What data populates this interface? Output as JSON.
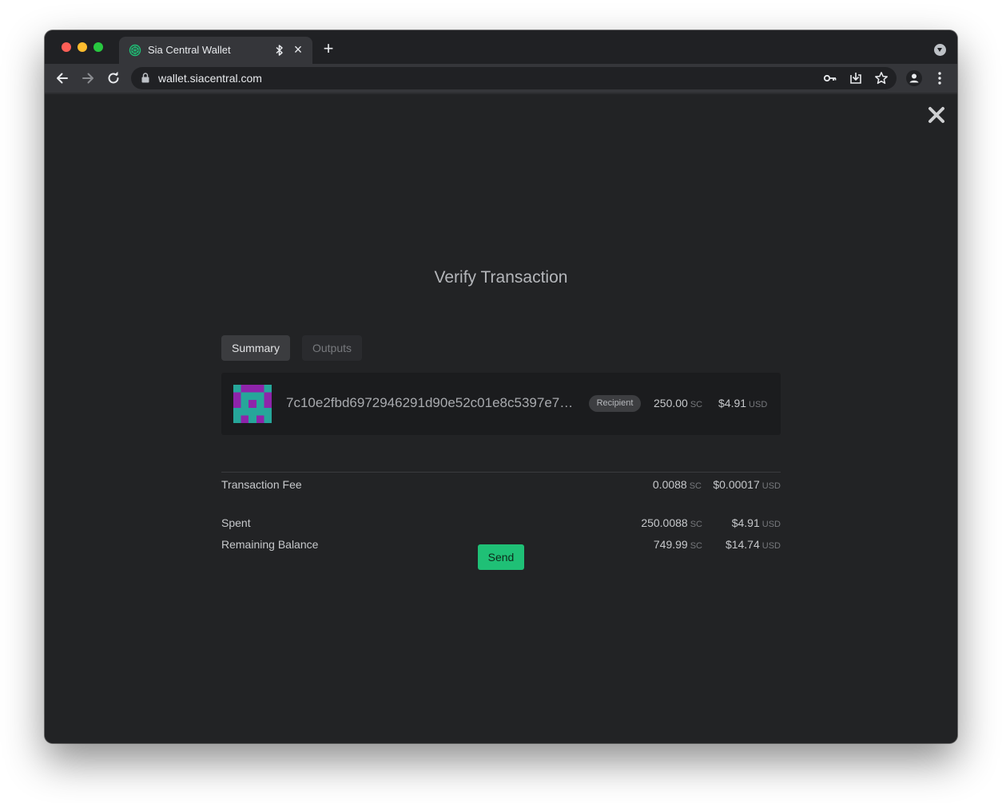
{
  "browser": {
    "tab_title": "Sia Central Wallet",
    "new_tab_symbol": "+",
    "close_tab_symbol": "×",
    "url": "wallet.siacentral.com"
  },
  "page": {
    "title": "Verify Transaction",
    "tabs": [
      {
        "label": "Summary",
        "active": true
      },
      {
        "label": "Outputs",
        "active": false
      }
    ],
    "recipient": {
      "address": "7c10e2fbd6972946291d90e52c01e8c5397e7…",
      "badge": "Recipient",
      "amount_sc": "250.00",
      "amount_usd": "$4.91",
      "unit_sc": "SC",
      "unit_usd": "USD"
    },
    "fee": {
      "label": "Transaction Fee",
      "sc": "0.0088",
      "usd": "$0.00017",
      "unit_sc": "SC",
      "unit_usd": "USD"
    },
    "spent": {
      "label": "Spent",
      "sc": "250.0088",
      "usd": "$4.91",
      "unit_sc": "SC",
      "unit_usd": "USD"
    },
    "remaining": {
      "label": "Remaining Balance",
      "sc": "749.99",
      "usd": "$14.74",
      "unit_sc": "SC",
      "unit_usd": "USD"
    },
    "send_label": "Send"
  },
  "colors": {
    "accent": "#1fc076",
    "identicon_primary": "#8e24aa",
    "identicon_secondary": "#26a69a"
  },
  "icons": [
    "sia-favicon-icon",
    "bluetooth-icon",
    "back-arrow-icon",
    "forward-arrow-icon",
    "reload-icon",
    "lock-icon",
    "key-icon",
    "install-icon",
    "star-icon",
    "profile-icon",
    "menu-icon",
    "close-icon"
  ]
}
